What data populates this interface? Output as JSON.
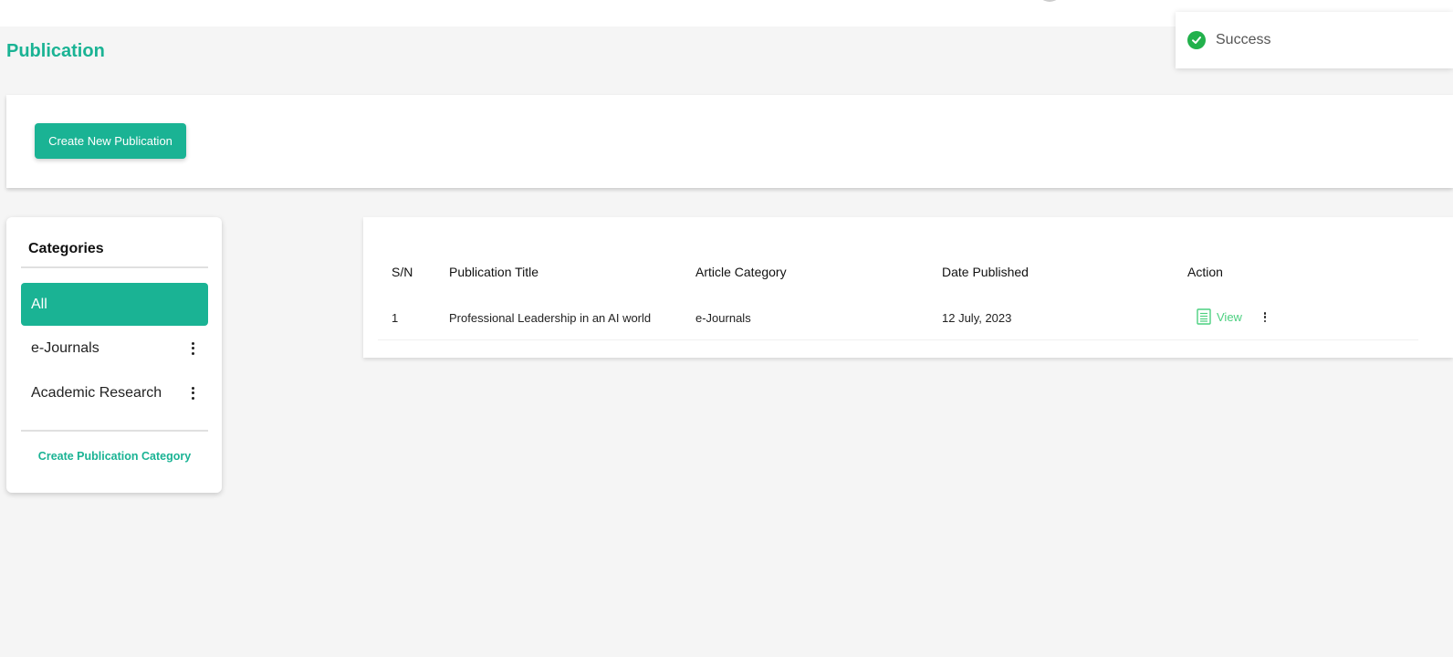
{
  "page": {
    "title": "Publication"
  },
  "toolbar": {
    "create_publication_label": "Create New Publication"
  },
  "categories": {
    "title": "Categories",
    "items": [
      {
        "label": "All",
        "active": true
      },
      {
        "label": "e-Journals",
        "active": false
      },
      {
        "label": "Academic Research",
        "active": false
      }
    ],
    "create_link_label": "Create Publication Category"
  },
  "table": {
    "headers": [
      "S/N",
      "Publication Title",
      "Article Category",
      "Date Published",
      "Action"
    ],
    "rows": [
      {
        "sn": "1",
        "title": "Professional Leadership in an AI world",
        "category": "e-Journals",
        "date": "12 July, 2023",
        "view_label": "View"
      }
    ]
  },
  "toast": {
    "message": "Success",
    "icon": "check-circle-icon",
    "color": "#22b14c"
  },
  "colors": {
    "accent": "#1ab394",
    "view_link": "#4cd080"
  }
}
